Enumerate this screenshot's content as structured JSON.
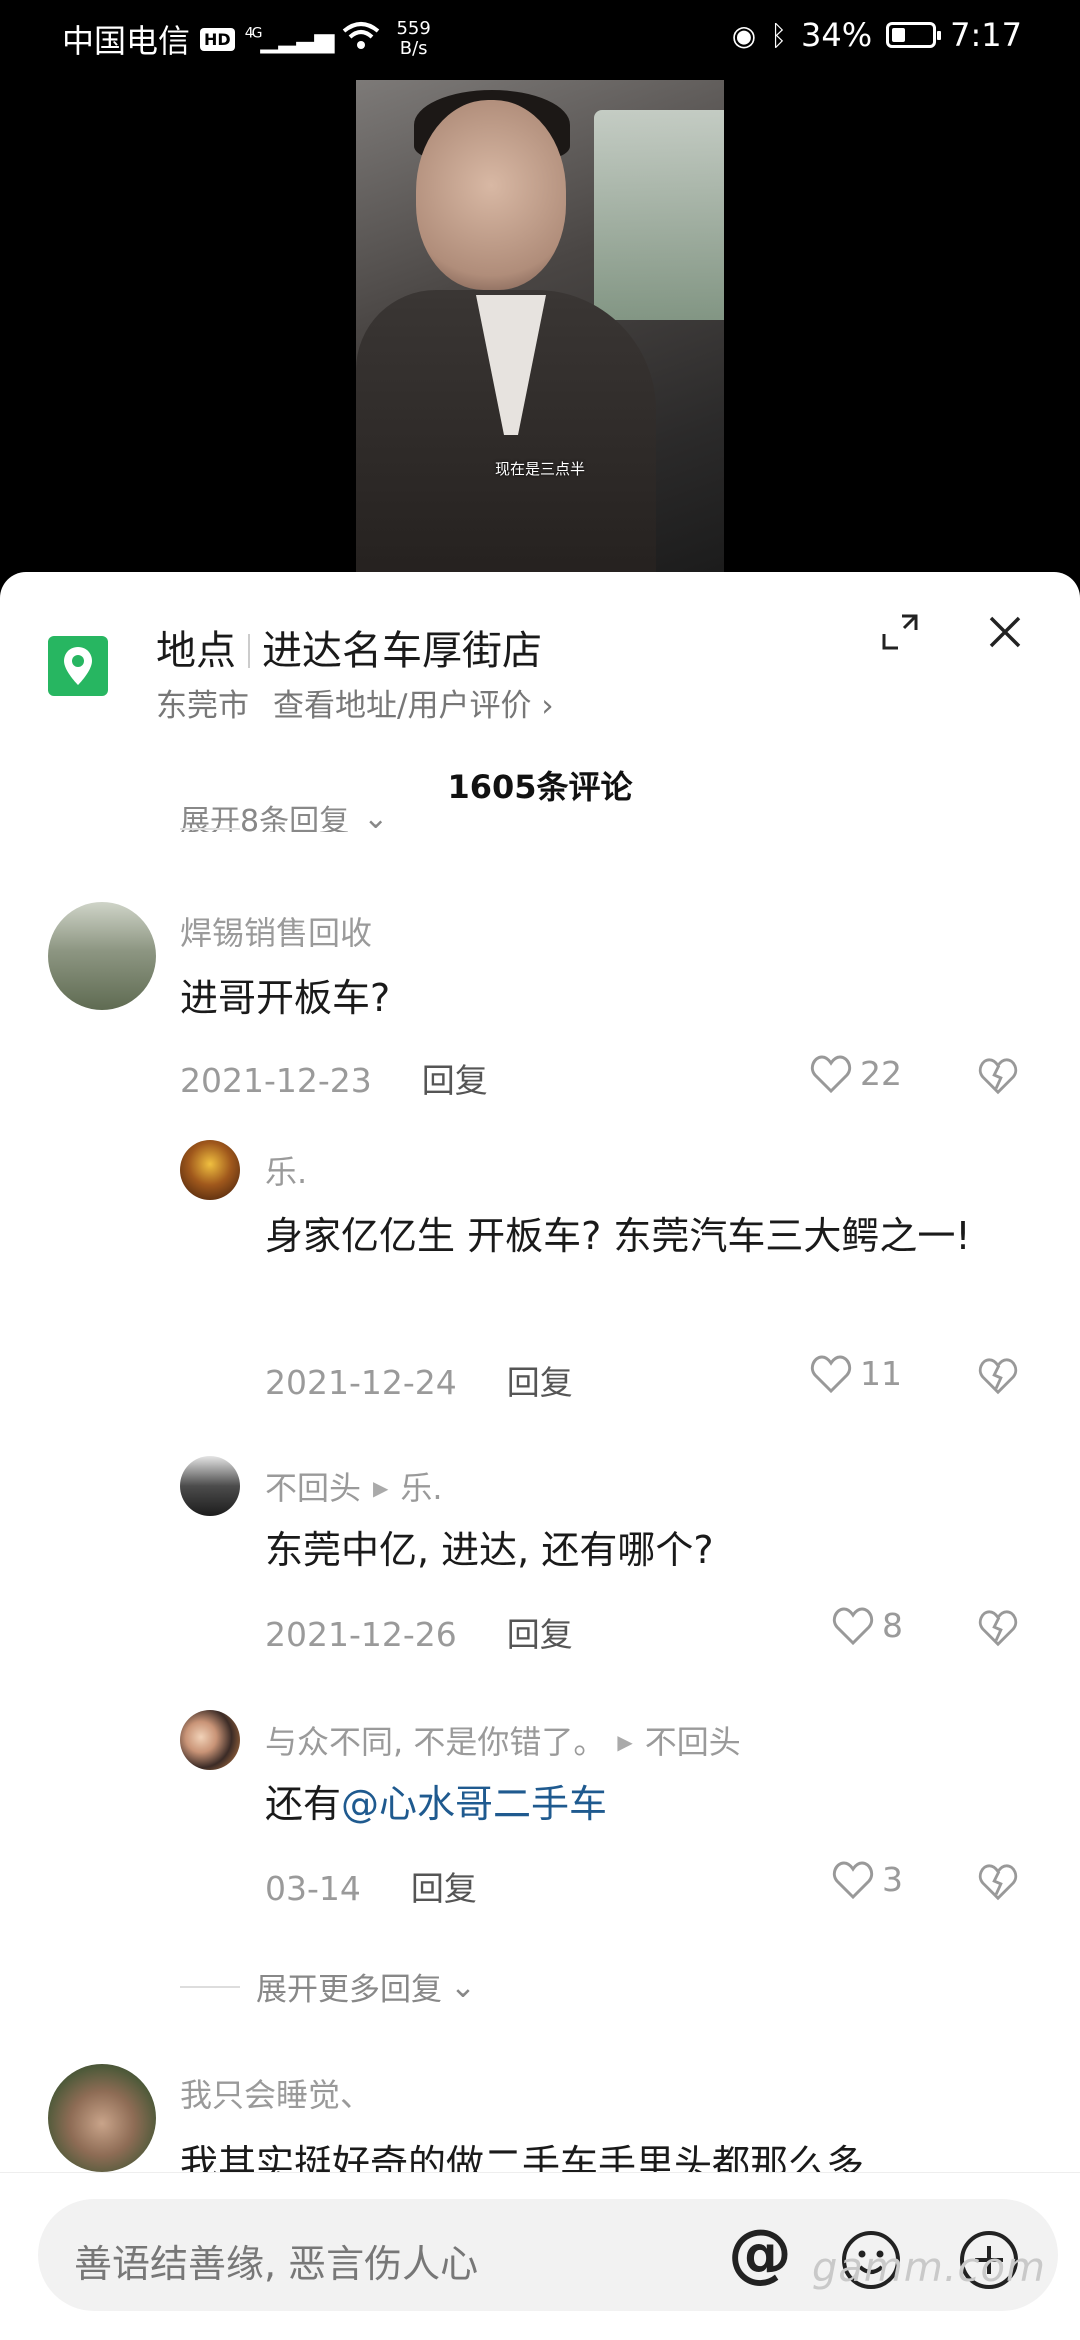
{
  "status_bar": {
    "carrier": "中国电信",
    "hd": "HD",
    "signal": "4G",
    "net_speed_value": "559",
    "net_speed_unit": "B/s",
    "battery": "34%",
    "battery_level": 0.34,
    "time": "7:17"
  },
  "video": {
    "subtitle": "现在是三点半"
  },
  "location": {
    "label": "地点",
    "name": "进达名车厚街店",
    "city": "东莞市",
    "link": "查看地址/用户评价 ›"
  },
  "comments_count": "1605条评论",
  "partial_expand": "展开8条回复",
  "comments": [
    {
      "user": "焊锡销售回收",
      "text": "进哥开板车?",
      "date": "2021-12-23",
      "reply_label": "回复",
      "likes": "22"
    },
    {
      "user": "乐.",
      "text": "身家亿亿生 开板车? 东莞汽车三大鳄之一!",
      "date": "2021-12-24",
      "reply_label": "回复",
      "likes": "11"
    },
    {
      "user": "不回头",
      "reply_to": "乐.",
      "text": "东莞中亿, 进达, 还有哪个?",
      "date": "2021-12-26",
      "reply_label": "回复",
      "likes": "8"
    },
    {
      "user": "与众不同, 不是你错了。",
      "reply_to": "不回头",
      "text_prefix": "还有",
      "mention": "@心水哥二手车",
      "date": "03-14",
      "reply_label": "回复",
      "likes": "3"
    },
    {
      "user": "我只会睡觉、",
      "text": "我其实挺好奇的做二手车手里头都那么多"
    }
  ],
  "more_replies": "展开更多回复",
  "input": {
    "placeholder": "善语结善缘, 恶言伤人心",
    "at": "@"
  },
  "watermark": "gamm.com",
  "colors": {
    "accent_green": "#27b661",
    "mention_blue": "#1f5a8f"
  }
}
